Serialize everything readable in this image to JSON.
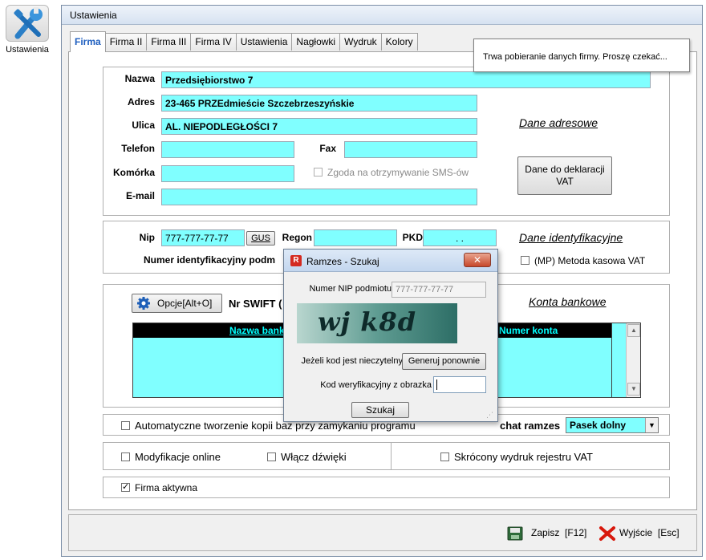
{
  "desktop_icon": {
    "label": "Ustawienia"
  },
  "window": {
    "title": "Ustawienia"
  },
  "tabs": [
    {
      "label": "Firma",
      "active": true
    },
    {
      "label": "Firma II"
    },
    {
      "label": "Firma III"
    },
    {
      "label": "Firma IV"
    },
    {
      "label": "Ustawienia"
    },
    {
      "label": "Nagłowki"
    },
    {
      "label": "Wydruk"
    },
    {
      "label": "Kolory"
    }
  ],
  "tooltip": "Trwa pobieranie danych firmy. Proszę czekać...",
  "address": {
    "nazwa_label": "Nazwa",
    "nazwa_value": "Przedsiębiorstwo 7",
    "adres_label": "Adres",
    "adres_value": "23-465 PRZEdmieście Szczebrzeszyńskie",
    "ulica_label": "Ulica",
    "ulica_value": "AL. NIEPODLEGŁOŚCI 7",
    "telefon_label": "Telefon",
    "telefon_value": "",
    "fax_label": "Fax",
    "fax_value": "",
    "komorka_label": "Komórka",
    "komorka_value": "",
    "sms_label": "Zgoda na otrzymywanie SMS-ów",
    "email_label": "E-mail",
    "email_value": "",
    "section_link": "Dane adresowe",
    "deklaracje_button_line1": "Dane do deklaracji",
    "deklaracje_button_line2": "VAT"
  },
  "ident": {
    "nip_label": "Nip",
    "nip_value": "777-777-77-77",
    "gus_button": "GUS",
    "regon_label": "Regon",
    "regon_value": "",
    "pkd_label": "PKD",
    "pkd_value": ". .",
    "numer_label": "Numer identyfikacyjny podm",
    "section_link": "Dane identyfikacyjne",
    "metoda_kasowa_label": "(MP) Metoda kasowa VAT"
  },
  "bank": {
    "opcje_button": "Opcje[Alt+O]",
    "swift_label": "Nr SWIFT (",
    "section_link": "Konta bankowe",
    "col_nazwa": "Nazwa bank",
    "col_numer": "Numer konta"
  },
  "options": {
    "auto_backup_label": "Automatyczne tworzenie kopii baz przy zamykaniu programu",
    "ramzes_label": "chat ramzes",
    "ramzes_select": "Pasek dolny",
    "modyfikacje_label": "Modyfikacje online",
    "dzwieki_label": "Włącz dźwięki",
    "skrocony_label": "Skrócony wydruk rejestru VAT",
    "firma_aktywna_label": "Firma aktywna"
  },
  "footer": {
    "zapisz_label": "Zapisz",
    "zapisz_key": "[F12]",
    "wyjscie_label": "Wyjście",
    "wyjscie_key": "[Esc]"
  },
  "dialog": {
    "title": "Ramzes - Szukaj",
    "close_label": "✕",
    "nip_label": "Numer NIP podmiotu",
    "nip_value": "777-777-77-77",
    "captcha_text": "wj k8d",
    "unreadable_label": "Jeżeli kod jest nieczytelny",
    "regenerate_button": "Generuj ponownie",
    "code_label": "Kod weryfikacyjny z obrazka",
    "code_value": "",
    "search_button": "Szukaj"
  },
  "colors": {
    "field_bg": "#80ffff",
    "table_header_bg": "#000000",
    "table_header_text": "#00ffff",
    "tab_active_text": "#1f5fbf"
  }
}
